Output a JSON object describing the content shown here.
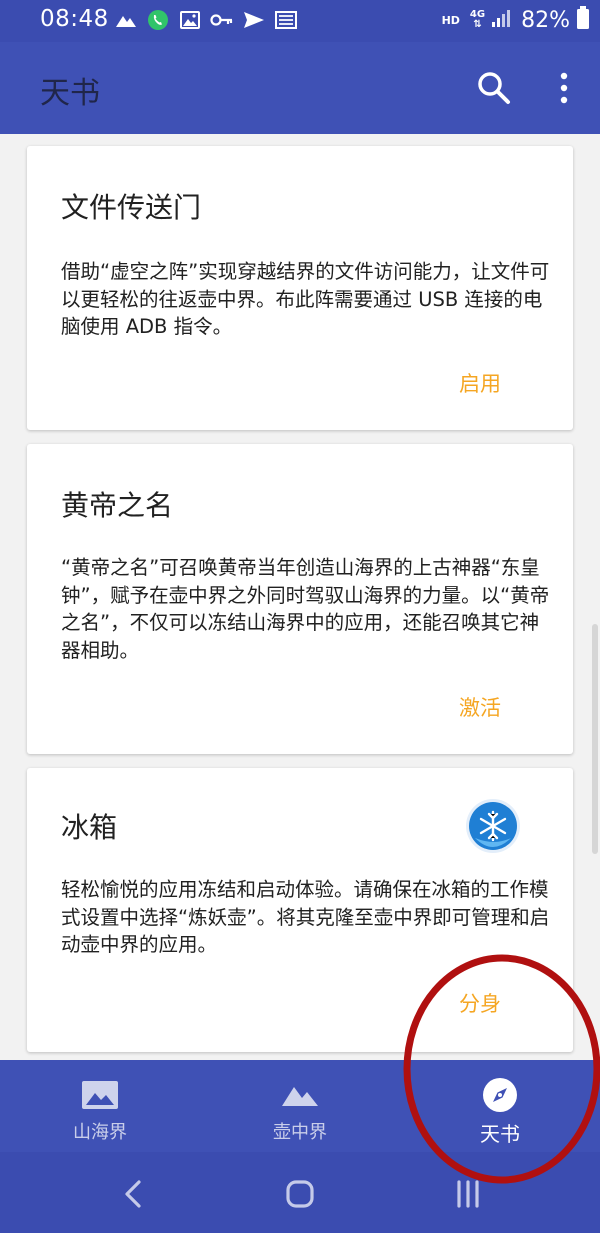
{
  "status_bar": {
    "time": "08:48",
    "network_label": "HD",
    "network_type": "4G",
    "battery": "82%"
  },
  "app_bar": {
    "title": "天书",
    "search_icon": "search-icon",
    "more_icon": "more-vert-icon"
  },
  "cards": [
    {
      "title": "文件传送门",
      "description": "借助“虚空之阵”实现穿越结界的文件访问能力，让文件可以更轻松的往返壶中界。布此阵需要通过 USB 连接的电脑使用 ADB 指令。",
      "action": "启用"
    },
    {
      "title": "黄帝之名",
      "description": "“黄帝之名”可召唤黄帝当年创造山海界的上古神器“东皇钟”，赋予在壶中界之外同时驾驭山海界的力量。以“黄帝之名”，不仅可以冻结山海界中的应用，还能召唤其它神器相助。",
      "action": "激活"
    },
    {
      "title": "冰箱",
      "description": "轻松愉悦的应用冻结和启动体验。请确保在冰箱的工作模式设置中选择“炼妖壶”。将其克隆至壶中界即可管理和启动壶中界的应用。",
      "action": "分身",
      "icon": "snowflake-app-icon"
    }
  ],
  "bottom_nav": {
    "items": [
      {
        "label": "山海界",
        "icon": "image-icon",
        "active": false
      },
      {
        "label": "壶中界",
        "icon": "mountain-icon",
        "active": false
      },
      {
        "label": "天书",
        "icon": "compass-icon",
        "active": true
      }
    ]
  },
  "colors": {
    "primary": "#3f51b5",
    "status_bar": "#3b4cb0",
    "accent": "#f5a623",
    "annotation": "#b01010"
  }
}
